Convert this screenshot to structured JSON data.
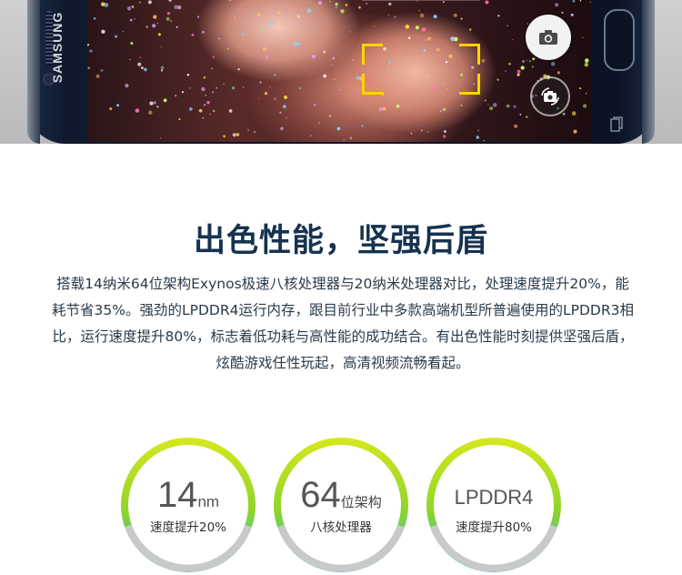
{
  "banner": {
    "brand": "SAMSUNG",
    "camera_icon": "camera-icon",
    "switch_icon": "switch-camera-icon",
    "recents_icon": "recents-icon",
    "accent_color": "#ffd400"
  },
  "title": "出色性能，坚强后盾",
  "description": "搭载14纳米64位架构Exynos极速八核处理器与20纳米处理器对比，处理速度提升20%，能耗节省35%。强劲的LPDDR4运行内存，跟目前行业中多款高端机型所普遍使用的LPDDR3相比，运行速度提升80%，标志着低功耗与高性能的成功结合。有出色性能时刻提供坚强后盾，炫酷游戏任性玩起，高清视频流畅看起。",
  "stats": [
    {
      "big": "14",
      "unit": "nm",
      "caption": "速度提升20%"
    },
    {
      "big": "64",
      "unit": "位架构",
      "caption": "八核处理器"
    },
    {
      "big": "LPDDR4",
      "unit": "",
      "caption": "速度提升80%"
    }
  ],
  "colors": {
    "title": "#16324f",
    "ring_green": "#c8e21a",
    "ring_teal": "#1ec0c8"
  }
}
